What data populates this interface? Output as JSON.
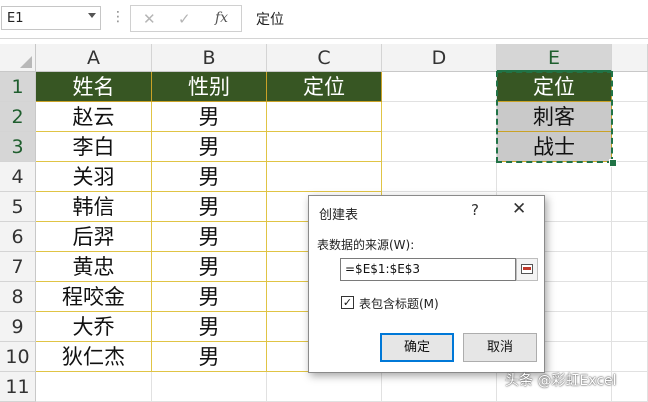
{
  "formula_bar": {
    "name_box": "E1",
    "cancel_icon": "✕",
    "enter_icon": "✓",
    "fx_label": "fx",
    "formula": "定位"
  },
  "columns": [
    "A",
    "B",
    "C",
    "D",
    "E"
  ],
  "selected_column": "E",
  "rows": [
    "1",
    "2",
    "3",
    "4",
    "5",
    "6",
    "7",
    "8",
    "9",
    "10",
    "11"
  ],
  "table": {
    "headers": [
      "姓名",
      "性别",
      "定位"
    ],
    "rows": [
      [
        "赵云",
        "男",
        ""
      ],
      [
        "李白",
        "男",
        ""
      ],
      [
        "关羽",
        "男",
        ""
      ],
      [
        "韩信",
        "男",
        ""
      ],
      [
        "后羿",
        "男",
        ""
      ],
      [
        "黄忠",
        "男",
        ""
      ],
      [
        "程咬金",
        "男",
        ""
      ],
      [
        "大乔",
        "男",
        ""
      ],
      [
        "狄仁杰",
        "男",
        ""
      ]
    ]
  },
  "side_range": {
    "header": "定位",
    "values": [
      "刺客",
      "战士"
    ]
  },
  "dialog": {
    "title": "创建表",
    "help": "?",
    "close": "✕",
    "source_label": "表数据的来源(W):",
    "source_value": "=$E$1:$E$3",
    "has_headers_checked": true,
    "has_headers_label": "表包含标题(M)",
    "ok_label": "确定",
    "cancel_label": "取消"
  },
  "watermark": "头条 @彩虹Excel",
  "colors": {
    "header_fill": "#375623",
    "table_border": "#e0c445",
    "range_fill": "#c9c9c9",
    "marquee": "#217346",
    "ok_focus": "#0078d7"
  }
}
